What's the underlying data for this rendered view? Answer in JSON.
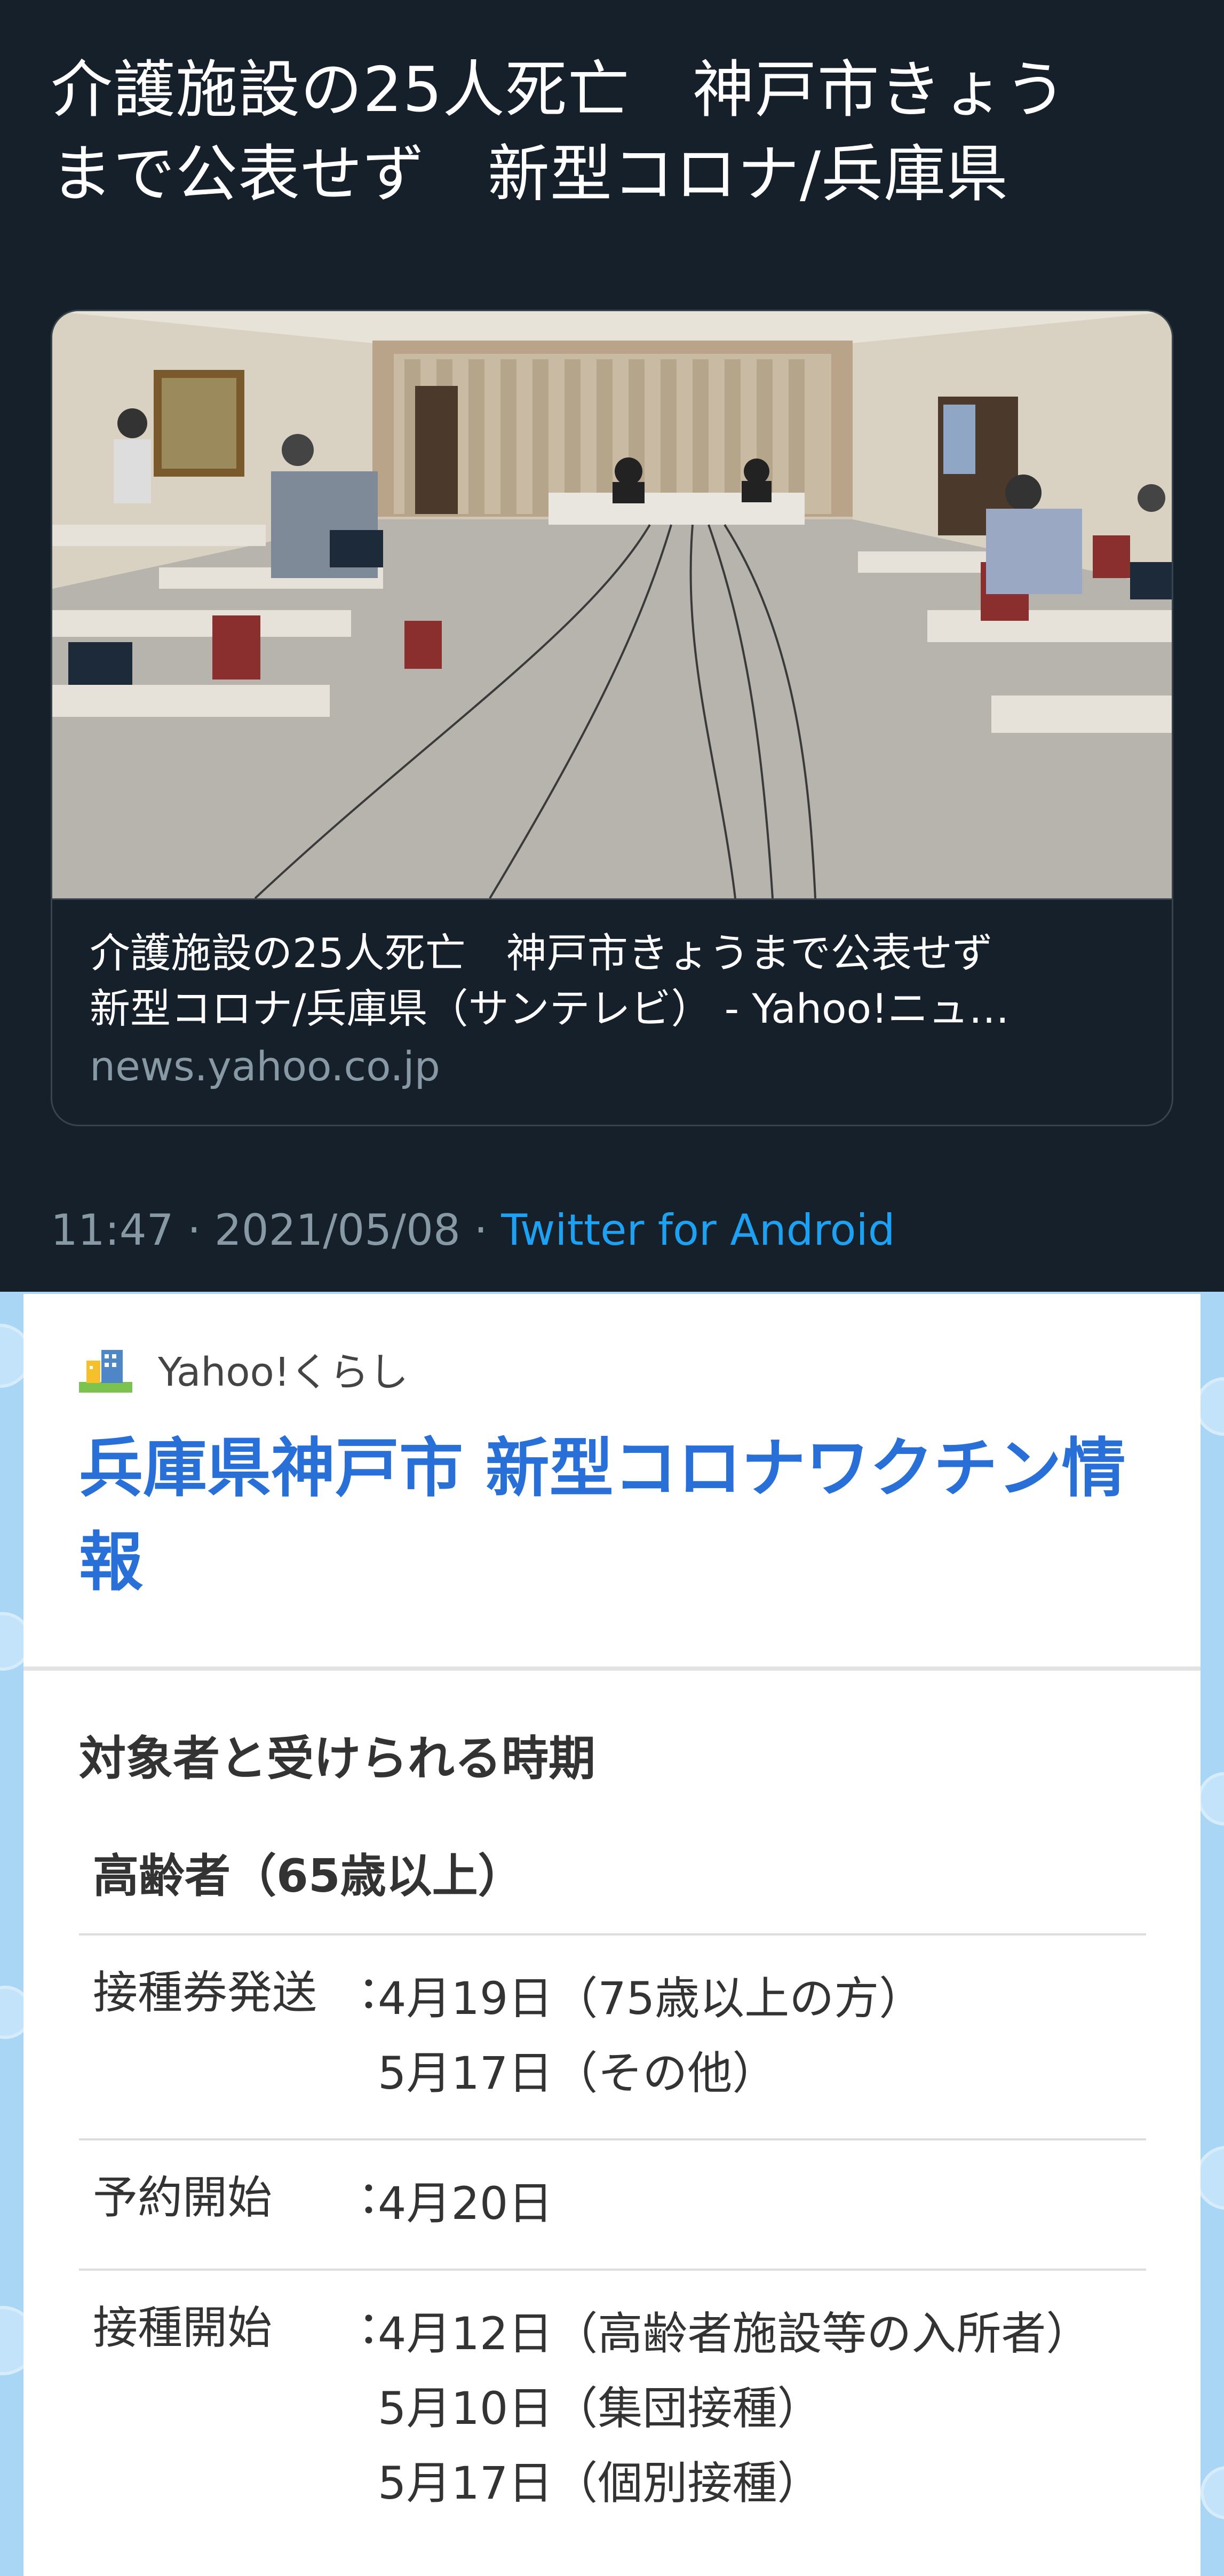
{
  "tweet": {
    "text": "介護施設の25人死亡　神戸市きょう\nまで公表せず　新型コロナ/兵庫県",
    "card": {
      "title": "介護施設の25人死亡　神戸市きょうまで公表せず\n新型コロナ/兵庫県（サンテレビ） - Yahoo!ニュ…",
      "domain": "news.yahoo.co.jp"
    },
    "timestamp": "11:47 · 2021/05/08 · ",
    "client": "Twitter for Android"
  },
  "yahoo": {
    "brand": "Yahoo!くらし",
    "page_title": "兵庫県神戸市 新型コロナワクチン情報",
    "section_heading": "対象者と受けられる時期",
    "group_heading": "高齢者（65歳以上）",
    "schedule": [
      {
        "label": "接種券発送",
        "values": [
          "4月19日（75歳以上の方）",
          "5月17日（その他）"
        ]
      },
      {
        "label": "予約開始",
        "values": [
          "4月20日"
        ]
      },
      {
        "label": "接種開始",
        "values": [
          "4月12日（高齢者施設等の入所者）",
          "5月10日（集団接種）",
          "5月17日（個別接種）"
        ]
      }
    ]
  },
  "colors": {
    "tweet_bg": "#15202b",
    "muted_text": "#8899a6",
    "link_blue": "#1da1f2",
    "yahoo_title_blue": "#2870d8"
  }
}
